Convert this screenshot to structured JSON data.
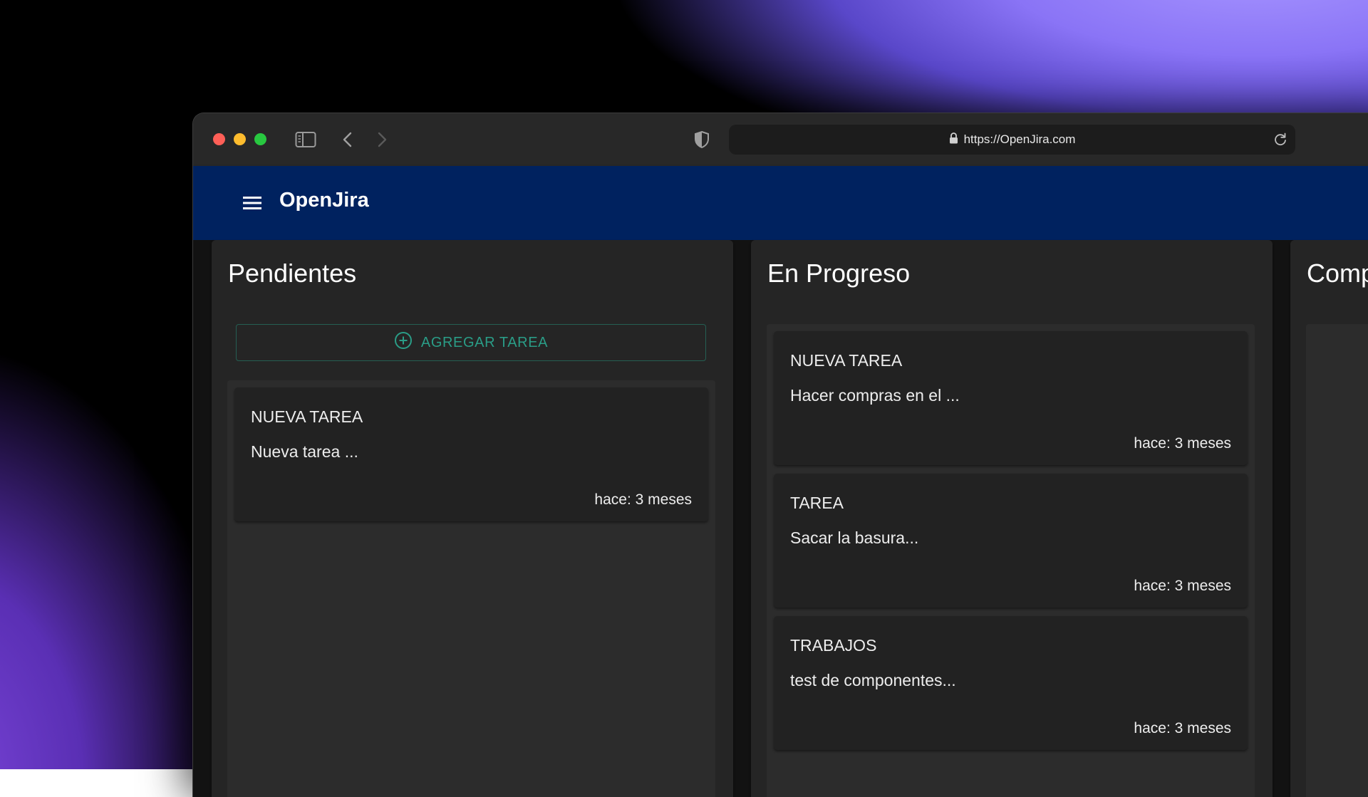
{
  "browser": {
    "url": "https://OpenJira.com"
  },
  "app": {
    "title": "OpenJira"
  },
  "columns": [
    {
      "title": "Pendientes",
      "add_button_label": "AGREGAR TAREA",
      "cards": [
        {
          "label": "NUEVA TAREA",
          "description": "Nueva tarea ...",
          "time": "hace: 3 meses"
        }
      ]
    },
    {
      "title": "En Progreso",
      "cards": [
        {
          "label": "NUEVA TAREA",
          "description": "Hacer compras en el ...",
          "time": "hace: 3 meses"
        },
        {
          "label": "TAREA",
          "description": "Sacar la basura...",
          "time": "hace: 3 meses"
        },
        {
          "label": "TRABAJOS",
          "description": "test de componentes...",
          "time": "hace: 3 meses"
        }
      ]
    },
    {
      "title": "Comp"
    }
  ],
  "colors": {
    "appbar": "#00225f",
    "accent": "#2a9d87",
    "background": "#121212",
    "column": "#252525",
    "card": "#222222"
  }
}
